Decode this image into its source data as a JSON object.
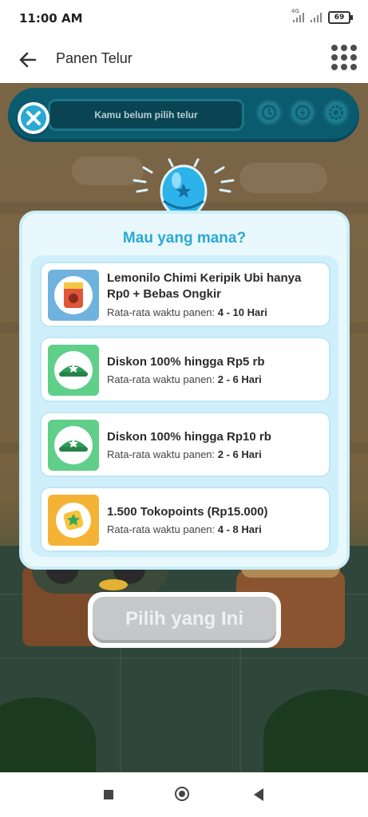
{
  "status_bar": {
    "time": "11:00 AM",
    "network": "4G",
    "battery": "69"
  },
  "app_bar": {
    "title": "Panen Telur"
  },
  "game": {
    "egg_field_text": "Kamu belum pilih telur"
  },
  "modal": {
    "title": "Mau yang mana?",
    "harvest_label": "Rata-rata waktu panen:",
    "options": [
      {
        "title": "Lemonilo Chimi Keripik Ubi hanya Rp0 + Bebas Ongkir",
        "harvest_time": "4 - 10 Hari",
        "icon": "snack-bag-icon"
      },
      {
        "title": "Diskon 100% hingga Rp5 rb",
        "harvest_time": "2 - 6 Hari",
        "icon": "green-hat-icon"
      },
      {
        "title": "Diskon 100% hingga Rp10 rb",
        "harvest_time": "2 - 6 Hari",
        "icon": "green-hat-icon"
      },
      {
        "title": "1.500 Tokopoints (Rp15.000)",
        "harvest_time": "4 - 8 Hari",
        "icon": "tokopoints-coin-icon"
      }
    ]
  },
  "pick_button": {
    "label": "Pilih yang Ini"
  },
  "colors": {
    "accent": "#2aa8d4",
    "bar": "#0b5b6e",
    "card_border": "#bfe7f6"
  }
}
